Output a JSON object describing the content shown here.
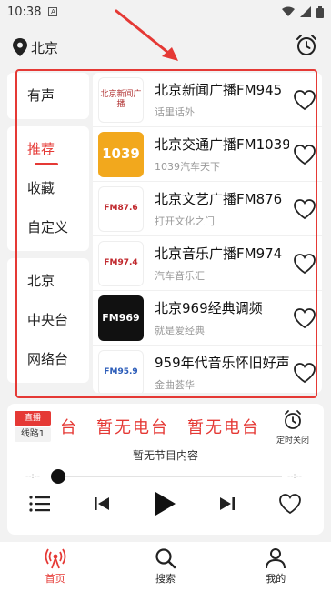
{
  "status": {
    "time": "10:38"
  },
  "header": {
    "location": "北京"
  },
  "tabs": {
    "group1": [
      "有声"
    ],
    "group2": [
      "推荐",
      "收藏",
      "自定义"
    ],
    "group3": [
      "北京",
      "中央台",
      "网络台"
    ],
    "active": "推荐"
  },
  "stations": [
    {
      "title": "北京新闻广播FM945",
      "subtitle": "话里话外",
      "logo_text": "北京新闻广播",
      "logo_bg": "#ffffff",
      "logo_fg": "#b03030"
    },
    {
      "title": "北京交通广播FM1039",
      "subtitle": "1039汽车天下",
      "logo_text": "1039",
      "logo_bg": "#f2a81d",
      "logo_fg": "#ffffff"
    },
    {
      "title": "北京文艺广播FM876",
      "subtitle": "打开文化之门",
      "logo_text": "FM87.6",
      "logo_bg": "#ffffff",
      "logo_fg": "#c0282d"
    },
    {
      "title": "北京音乐广播FM974",
      "subtitle": "汽车音乐汇",
      "logo_text": "FM97.4",
      "logo_bg": "#ffffff",
      "logo_fg": "#c0282d"
    },
    {
      "title": "北京969经典调频",
      "subtitle": "就是爱经典",
      "logo_text": "FM969",
      "logo_bg": "#111111",
      "logo_fg": "#ffffff"
    },
    {
      "title": "959年代音乐怀旧好声音",
      "subtitle": "金曲荟华",
      "logo_text": "FM95.9",
      "logo_bg": "#ffffff",
      "logo_fg": "#2a5bb8"
    }
  ],
  "player": {
    "live_label": "直播",
    "line_label": "线路1",
    "marquee": "台　暂无电台　暂无电台",
    "timer_label": "定时关闭",
    "program": "暂无节目内容",
    "time_start": "--:--",
    "time_end": "--:--",
    "progress": 0
  },
  "nav": [
    {
      "label": "首页",
      "active": true
    },
    {
      "label": "搜索",
      "active": false
    },
    {
      "label": "我的",
      "active": false
    }
  ],
  "colors": {
    "accent": "#e53935"
  }
}
